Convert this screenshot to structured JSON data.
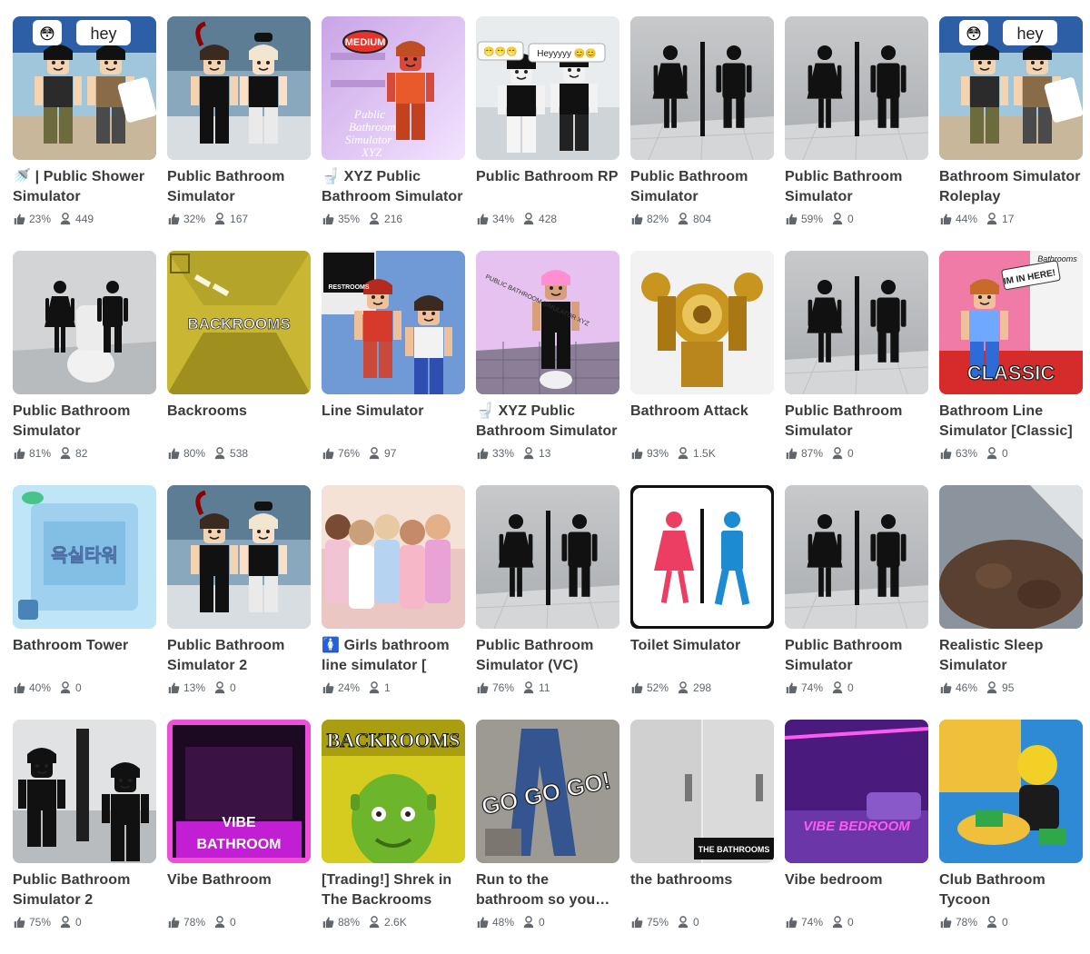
{
  "games": [
    {
      "title": "🚿 | Public Shower Simulator",
      "rating": "23%",
      "players": "449",
      "thumb": "avatars-hey"
    },
    {
      "title": "Public Bathroom Simulator",
      "rating": "32%",
      "players": "167",
      "thumb": "avatar-duo"
    },
    {
      "title": "🚽 XYZ Public Bathroom Simulator",
      "rating": "35%",
      "players": "216",
      "thumb": "xyz-pink",
      "thumb_text": [
        "MEDIUM",
        "Public",
        "Bathroom",
        "Simulator",
        "XYZ"
      ]
    },
    {
      "title": "Public Bathroom RP",
      "rating": "34%",
      "players": "428",
      "thumb": "rp-dark",
      "thumb_text": [
        "😁😁😁",
        "Heyyyyy 😊😊"
      ]
    },
    {
      "title": "Public Bathroom Simulator",
      "rating": "82%",
      "players": "804",
      "thumb": "restroom-sign"
    },
    {
      "title": "Public Bathroom Simulator",
      "rating": "59%",
      "players": "0",
      "thumb": "restroom-sign"
    },
    {
      "title": "Bathroom Simulator Roleplay",
      "rating": "44%",
      "players": "17",
      "thumb": "avatars-hey"
    },
    {
      "title": "Public Bathroom Simulator",
      "rating": "81%",
      "players": "82",
      "thumb": "restroom-toilet"
    },
    {
      "title": "Backrooms",
      "rating": "80%",
      "players": "538",
      "thumb": "backrooms-yellow",
      "thumb_text": [
        "BACKROOMS"
      ]
    },
    {
      "title": "Line Simulator",
      "rating": "76%",
      "players": "97",
      "thumb": "line-sim",
      "thumb_text": [
        "RESTROOMS"
      ]
    },
    {
      "title": "🚽 XYZ Public Bathroom Simulator",
      "rating": "33%",
      "players": "13",
      "thumb": "xyz-toilet",
      "thumb_text": [
        "PUBLIC BATHROOM SIMULATOR XYZ"
      ]
    },
    {
      "title": "Bathroom Attack",
      "rating": "93%",
      "players": "1.5K",
      "thumb": "gold-mech"
    },
    {
      "title": "Public Bathroom Simulator",
      "rating": "87%",
      "players": "0",
      "thumb": "restroom-sign"
    },
    {
      "title": "Bathroom Line Simulator [Classic]",
      "rating": "63%",
      "players": "0",
      "thumb": "classic",
      "thumb_text": [
        "IM IN HERE!",
        "Bathrooms",
        "CLASSIC"
      ]
    },
    {
      "title": "Bathroom Tower",
      "rating": "40%",
      "players": "0",
      "thumb": "tower",
      "thumb_text": [
        "욕실타워"
      ]
    },
    {
      "title": "Public Bathroom Simulator 2",
      "rating": "13%",
      "players": "0",
      "thumb": "avatar-duo"
    },
    {
      "title": "🚺 Girls bathroom line simulator [",
      "rating": "24%",
      "players": "1",
      "thumb": "girls"
    },
    {
      "title": "Public Bathroom Simulator (VC)",
      "rating": "76%",
      "players": "11",
      "thumb": "restroom-sign"
    },
    {
      "title": "Toilet Simulator",
      "rating": "52%",
      "players": "298",
      "thumb": "toilet-sign"
    },
    {
      "title": "Public Bathroom Simulator",
      "rating": "74%",
      "players": "0",
      "thumb": "restroom-sign"
    },
    {
      "title": "Realistic Sleep Simulator",
      "rating": "46%",
      "players": "95",
      "thumb": "sleep"
    },
    {
      "title": "Public Bathroom Simulator 2",
      "rating": "75%",
      "players": "0",
      "thumb": "stalls-dark"
    },
    {
      "title": "Vibe Bathroom",
      "rating": "78%",
      "players": "0",
      "thumb": "vibe-bath",
      "thumb_text": [
        "VIBE",
        "BATHROOM"
      ]
    },
    {
      "title": "[Trading!] Shrek in The Backrooms",
      "rating": "88%",
      "players": "2.6K",
      "thumb": "shrek",
      "thumb_text": [
        "BACKROOMS"
      ]
    },
    {
      "title": "Run to the bathroom so you don't pee",
      "rating": "48%",
      "players": "0",
      "thumb": "gogogo",
      "thumb_text": [
        "GO GO GO!"
      ]
    },
    {
      "title": "the bathrooms",
      "rating": "75%",
      "players": "0",
      "thumb": "the-bathrooms",
      "thumb_text": [
        "THE BATHROOMS"
      ]
    },
    {
      "title": "Vibe bedroom",
      "rating": "74%",
      "players": "0",
      "thumb": "vibe-bed",
      "thumb_text": [
        "VIBE BEDROOM"
      ]
    },
    {
      "title": "Club Bathroom Tycoon",
      "rating": "78%",
      "players": "0",
      "thumb": "club"
    }
  ]
}
